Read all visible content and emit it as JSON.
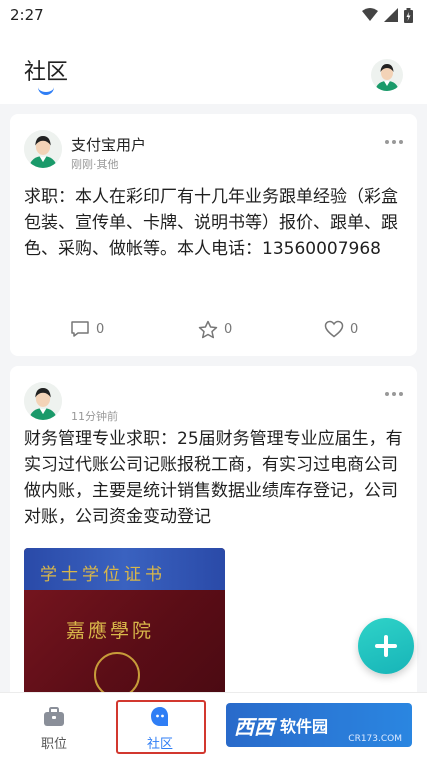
{
  "status_bar": {
    "time": "2:27"
  },
  "header": {
    "title": "社区"
  },
  "posts": [
    {
      "username": "支付宝用户",
      "meta": "刚刚·其他",
      "text": "求职：本人在彩印厂有十几年业务跟单经验（彩盒包装、宣传单、卡牌、说明书等）报价、跟单、跟色、采购、做帐等。本人电话：13560007968",
      "comments": "0",
      "stars": "0",
      "likes": "0"
    },
    {
      "username": "",
      "meta": "11分钟前",
      "text": "财务管理专业求职：25届财务管理专业应届生，有实习过代账公司记账报税工商，有实习过电商公司做内账，主要是统计销售数据业绩库存登记，公司对账，公司资金变动登记",
      "image_text": {
        "title": "学士学位证书",
        "school": "嘉應學院"
      }
    }
  ],
  "bottom_nav": {
    "items": [
      {
        "label": "职位",
        "icon": "briefcase-icon"
      },
      {
        "label": "社区",
        "icon": "chat-bubble-icon",
        "active": true
      }
    ]
  },
  "watermark": {
    "logo": "西西",
    "main": "软件园",
    "sub": "CR173.COM"
  },
  "colors": {
    "accent": "#2f7ef5",
    "fab": "#1fc3bf",
    "highlight": "#d2382f"
  }
}
